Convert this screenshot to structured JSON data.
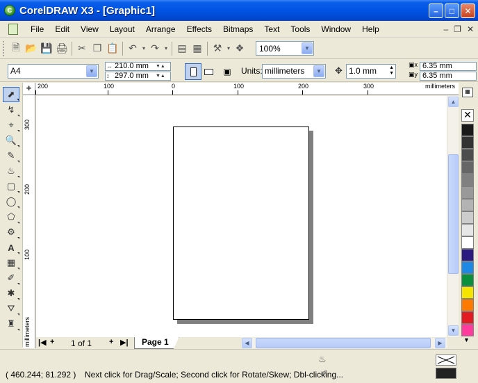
{
  "window": {
    "title": "CorelDRAW X3 - [Graphic1]",
    "app_icon": "coreldraw-icon"
  },
  "menu": {
    "items": [
      {
        "label": "File"
      },
      {
        "label": "Edit"
      },
      {
        "label": "View"
      },
      {
        "label": "Layout"
      },
      {
        "label": "Arrange"
      },
      {
        "label": "Effects"
      },
      {
        "label": "Bitmaps"
      },
      {
        "label": "Text"
      },
      {
        "label": "Tools"
      },
      {
        "label": "Window"
      },
      {
        "label": "Help"
      }
    ]
  },
  "toolbar": {
    "zoom": "100%"
  },
  "propbar": {
    "page_size": "A4",
    "width": "210.0 mm",
    "height": "297.0 mm",
    "units_label": "Units:",
    "units": "millimeters",
    "nudge": "1.0 mm",
    "dup_x": "6.35 mm",
    "dup_y": "6.35 mm"
  },
  "rulers": {
    "h_labels": [
      "200",
      "100",
      "0",
      "100",
      "200",
      "300"
    ],
    "h_unit": "millimeters",
    "v_labels": [
      "300",
      "200",
      "100"
    ],
    "v_unit": "millimeters"
  },
  "pagenav": {
    "count": "1 of 1",
    "tab": "Page 1"
  },
  "palette": {
    "colors": [
      "#1a1a1a",
      "#333333",
      "#4d4d4d",
      "#666666",
      "#808080",
      "#999999",
      "#b3b3b3",
      "#cccccc",
      "#e6e6e6",
      "#ffffff",
      "#2b1a80",
      "#1e88e5",
      "#0a8f3c",
      "#f5e400",
      "#ff7a00",
      "#e31b23",
      "#ff3c9e"
    ]
  },
  "status": {
    "coords": "( 460.244; 81.292 )",
    "hint": "Next click for Drag/Scale; Second click for Rotate/Skew; Dbl-clicking..."
  }
}
